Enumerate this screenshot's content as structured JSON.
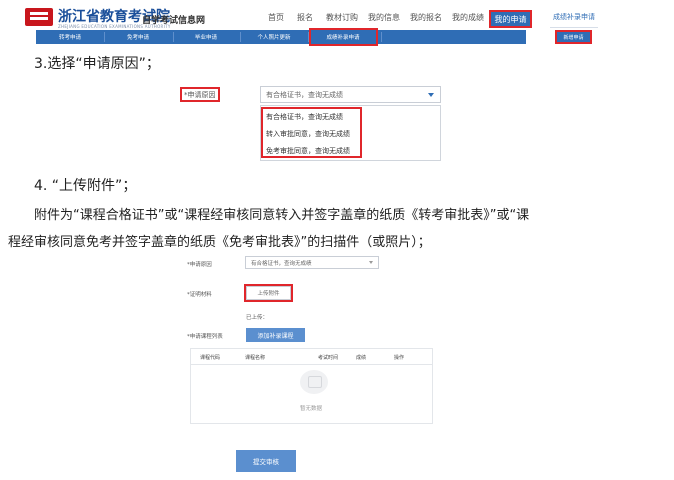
{
  "header": {
    "site_name": "浙江省教育考试院",
    "site_name_en": "ZHEJIANG EDUCATION EXAMINATIONS AUTHORITY",
    "slogan": "自学考试信息网",
    "nav": [
      "首页",
      "报名",
      "教材订购",
      "我的信息",
      "我的报名",
      "我的成绩",
      "我的申请"
    ],
    "active_nav": "我的申请",
    "subnav": [
      "转考申请",
      "免考申请",
      "毕业申请",
      "个人照片更新",
      "成绩补录申请"
    ],
    "side_title": "成绩补录申请",
    "side_button": "新增申请"
  },
  "step3": {
    "heading": "3.选择“申请原因”；",
    "field_label": "*申请原因",
    "select_value": "有合格证书，查询无成绩",
    "options": [
      "有合格证书，查询无成绩",
      "转入审批同意，查询无成绩",
      "免考审批同意，查询无成绩"
    ]
  },
  "step4": {
    "heading": "4. “上传附件”；",
    "para_line1": "附件为“课程合格证书”或“课程经审核同意转入并签字盖章的纸质《转考审批表》”或“课",
    "para_line2": "程经审核同意免考并签字盖章的纸质《免考审批表》”的扫描件（或照片）；"
  },
  "form2": {
    "reason_label": "*申请原因",
    "reason_value": "有合格证书，查询无成绩",
    "proof_label": "*证明材料",
    "upload_button": "上传附件",
    "uploaded_label": "已上传：",
    "course_list_label": "*申请课程列表",
    "add_course_button": "添加补录课程",
    "table_headers": [
      "课程代码",
      "课程名称",
      "考试时间",
      "成绩",
      "操作"
    ],
    "empty_text": "暂无数据",
    "submit_button": "提交审核"
  },
  "colors": {
    "brand_blue": "#2f6db5",
    "highlight_red": "#e0262b",
    "button_blue": "#5b8fcf"
  }
}
